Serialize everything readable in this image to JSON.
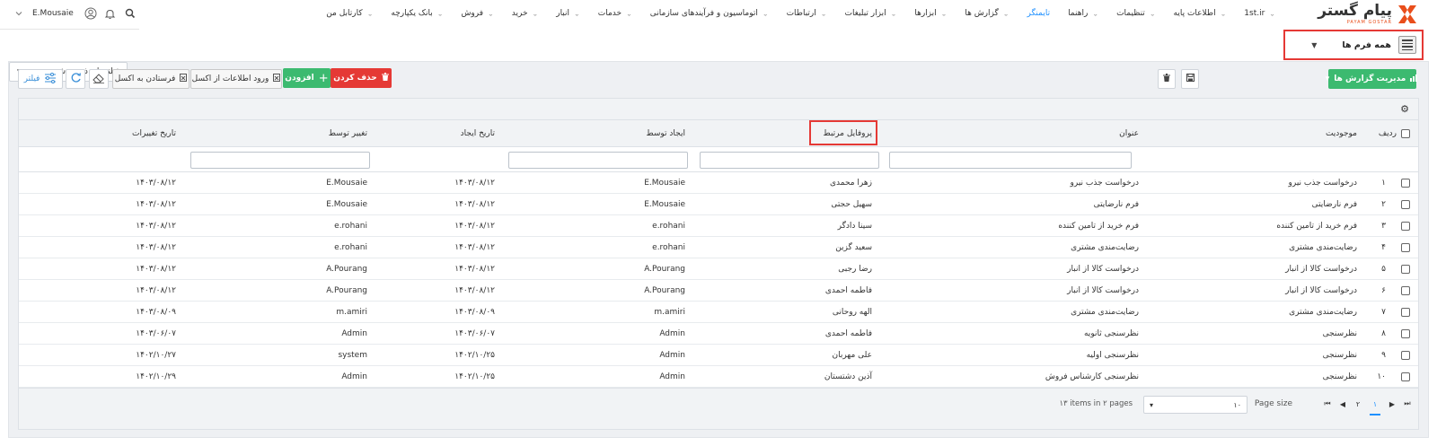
{
  "brand": {
    "name": "پیام گستر",
    "subtitle": "PAYAM GOSTAR"
  },
  "nav": [
    {
      "label": "کارتابل من",
      "chevron": true
    },
    {
      "label": "بانک یکپارچه",
      "chevron": true
    },
    {
      "label": "فروش",
      "chevron": true
    },
    {
      "label": "خرید",
      "chevron": true
    },
    {
      "label": "انبار",
      "chevron": true
    },
    {
      "label": "خدمات",
      "chevron": true
    },
    {
      "label": "اتوماسیون و فرآیندهای سازمانی",
      "chevron": true
    },
    {
      "label": "ارتباطات",
      "chevron": true
    },
    {
      "label": "ابزار تبلیغات",
      "chevron": true
    },
    {
      "label": "ابزارها",
      "chevron": true
    },
    {
      "label": "گزارش ها",
      "chevron": true
    },
    {
      "label": "تایمنگر",
      "chevron": false,
      "active": true
    },
    {
      "label": "راهنما",
      "chevron": true
    },
    {
      "label": "تنظیمات",
      "chevron": true
    },
    {
      "label": "اطلاعات پایه",
      "chevron": true
    },
    {
      "label": "1st.ir",
      "chevron": true
    }
  ],
  "user": {
    "name": "E.Mousaie"
  },
  "form_selector": {
    "title": "همه فرم ها"
  },
  "toolbar": {
    "report_management": "مدیریت گزارش ها",
    "saved_filters": "فیلترهای ذخیره شده",
    "delete": "حذف کردن",
    "add": "افزودن",
    "import_excel": "ورود اطلاعات از اکسل",
    "export_excel": "فرستادن به اکسل",
    "filter": "فیلتر"
  },
  "columns": {
    "row": "ردیف",
    "entity": "موجودیت",
    "title": "عنوان",
    "profile": "پروفایل مرتبط",
    "created_by": "ایجاد توسط",
    "created_at": "تاریخ ایجاد",
    "modified_by": "تغییر توسط",
    "modified_at": "تاریخ تغییرات"
  },
  "rows": [
    {
      "num": "۱",
      "entity": "درخواست جذب نیرو",
      "title": "درخواست جذب نیرو",
      "profile": "زهرا محمدی",
      "created_by": "E.Mousaie",
      "created_at": "۱۴۰۳/۰۸/۱۲",
      "modified_by": "E.Mousaie",
      "modified_at": "۱۴۰۳/۰۸/۱۲"
    },
    {
      "num": "۲",
      "entity": "فرم نارضایتی",
      "title": "فرم نارضایتی",
      "profile": "سهیل حجتی",
      "created_by": "E.Mousaie",
      "created_at": "۱۴۰۳/۰۸/۱۲",
      "modified_by": "E.Mousaie",
      "modified_at": "۱۴۰۳/۰۸/۱۲"
    },
    {
      "num": "۳",
      "entity": "فرم خرید از تامین کننده",
      "title": "فرم خرید از تامین کننده",
      "profile": "سینا دادگر",
      "created_by": "e.rohani",
      "created_at": "۱۴۰۳/۰۸/۱۲",
      "modified_by": "e.rohani",
      "modified_at": "۱۴۰۳/۰۸/۱۲"
    },
    {
      "num": "۴",
      "entity": "رضایت‌مندی مشتری",
      "title": "رضایت‌مندی مشتری",
      "profile": "سعید گزین",
      "created_by": "e.rohani",
      "created_at": "۱۴۰۳/۰۸/۱۲",
      "modified_by": "e.rohani",
      "modified_at": "۱۴۰۳/۰۸/۱۲"
    },
    {
      "num": "۵",
      "entity": "درخواست کالا از انبار",
      "title": "درخواست کالا از انبار",
      "profile": "رضا رجبی",
      "created_by": "A.Pourang",
      "created_at": "۱۴۰۳/۰۸/۱۲",
      "modified_by": "A.Pourang",
      "modified_at": "۱۴۰۳/۰۸/۱۲"
    },
    {
      "num": "۶",
      "entity": "درخواست کالا از انبار",
      "title": "درخواست کالا از انبار",
      "profile": "فاطمه احمدی",
      "created_by": "A.Pourang",
      "created_at": "۱۴۰۳/۰۸/۱۲",
      "modified_by": "A.Pourang",
      "modified_at": "۱۴۰۳/۰۸/۱۲"
    },
    {
      "num": "۷",
      "entity": "رضایت‌مندی مشتری",
      "title": "رضایت‌مندی مشتری",
      "profile": "الهه روحانی",
      "created_by": "m.amiri",
      "created_at": "۱۴۰۳/۰۸/۰۹",
      "modified_by": "m.amiri",
      "modified_at": "۱۴۰۳/۰۸/۰۹"
    },
    {
      "num": "۸",
      "entity": "نظرسنجی",
      "title": "نظرسنجی ثانویه",
      "profile": "فاطمه احمدی",
      "created_by": "Admin",
      "created_at": "۱۴۰۳/۰۶/۰۷",
      "modified_by": "Admin",
      "modified_at": "۱۴۰۳/۰۶/۰۷"
    },
    {
      "num": "۹",
      "entity": "نظرسنجی",
      "title": "نظرسنجی اولیه",
      "profile": "علی مهربان",
      "created_by": "Admin",
      "created_at": "۱۴۰۲/۱۰/۲۵",
      "modified_by": "system",
      "modified_at": "۱۴۰۲/۱۰/۲۷"
    },
    {
      "num": "۱۰",
      "entity": "نظرسنجی",
      "title": "نظرسنجی کارشناس فروش",
      "profile": "آذین دشتستان",
      "created_by": "Admin",
      "created_at": "۱۴۰۲/۱۰/۲۵",
      "modified_by": "Admin",
      "modified_at": "۱۴۰۲/۱۰/۲۹"
    }
  ],
  "pager": {
    "pages": [
      "۱",
      "۲"
    ],
    "active_page": "۱",
    "page_size_label": "Page size",
    "page_size": "۱۰",
    "items_info": "۱۳ items in ۲ pages"
  },
  "colors": {
    "accent_green": "#3cba70",
    "danger_red": "#e53935",
    "highlight_box": "#e53935",
    "active_link": "#1e90ff"
  }
}
